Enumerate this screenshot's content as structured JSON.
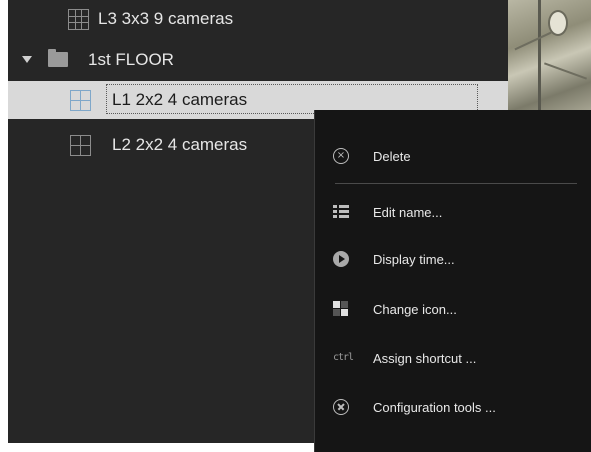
{
  "tree": {
    "rows": [
      {
        "label": "L3 3x3 9 cameras",
        "icon": "grid-3x3-icon"
      },
      {
        "label": "1st FLOOR",
        "icon": "folder-icon",
        "expanded": true
      },
      {
        "label": "L1 2x2 4 cameras",
        "icon": "grid-2x2-icon",
        "selected": true
      },
      {
        "label": "L2 2x2 4 cameras",
        "icon": "grid-2x2-icon"
      }
    ]
  },
  "context_menu": {
    "items": [
      {
        "label": "Delete",
        "icon": "delete-circle-x-icon"
      },
      {
        "label": "Edit name...",
        "icon": "list-icon"
      },
      {
        "label": "Display time...",
        "icon": "play-circle-icon"
      },
      {
        "label": "Change icon...",
        "icon": "checker-icon"
      },
      {
        "label": "Assign shortcut ...",
        "icon": "keyboard-shortcut-icon"
      },
      {
        "label": "Configuration tools ...",
        "icon": "tools-icon"
      }
    ]
  },
  "colors": {
    "panel_bg": "#262626",
    "menu_bg": "#151515",
    "selected_bg": "#d9d9d9",
    "text": "#e6e6e6"
  }
}
